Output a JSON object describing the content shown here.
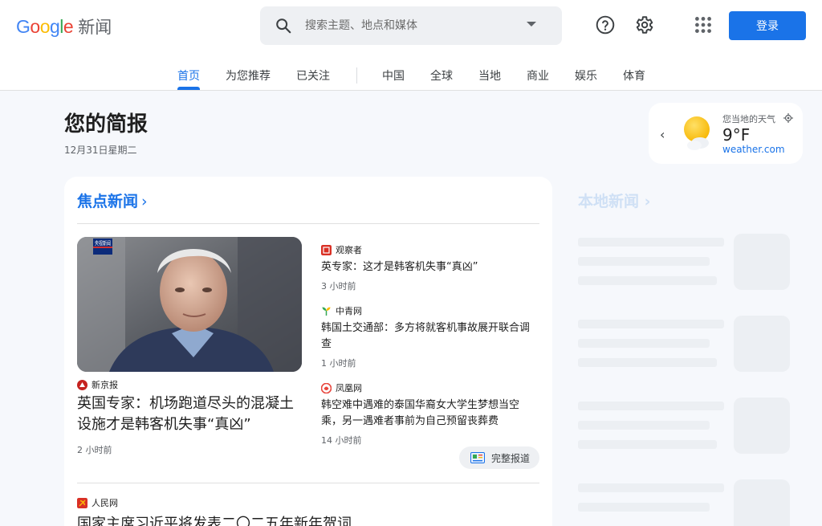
{
  "header": {
    "logo_google": [
      "G",
      "o",
      "o",
      "g",
      "l",
      "e"
    ],
    "logo_suffix": "新闻",
    "search_placeholder": "搜索主题、地点和媒体",
    "login_label": "登录"
  },
  "tabs": [
    "首页",
    "为您推荐",
    "已关注",
    "中国",
    "全球",
    "当地",
    "商业",
    "娱乐",
    "体育"
  ],
  "briefing": {
    "title": "您的简报",
    "date": "12月31日星期二"
  },
  "weather": {
    "label": "您当地的天气",
    "temp": "9°F",
    "source": "weather.com"
  },
  "top_stories": {
    "heading": "焦点新闻",
    "hero": {
      "badge": "央视新闻",
      "source": "新京报",
      "title": "英国专家：机场跑道尽头的混凝土设施才是韩客机失事“真凶”",
      "time": "2 小时前"
    },
    "side": [
      {
        "source": "观察者",
        "title": "英专家：这才是韩客机失事“真凶”",
        "time": "3 小时前"
      },
      {
        "source": "中青网",
        "title": "韩国土交通部：多方将就客机事故展开联合调查",
        "time": "1 小时前"
      },
      {
        "source": "凤凰网",
        "title": "韩空难中遇难的泰国华裔女大学生梦想当空乘，另一遇难者事前为自己预留丧葬费",
        "time": "14 小时前"
      }
    ],
    "full_coverage": "完整报道",
    "next": {
      "source": "人民网",
      "title": "国家主席习近平将发表二〇二五年新年贺词"
    }
  },
  "local_news": {
    "heading": "本地新闻"
  },
  "colors": {
    "accent": "#1a73e8",
    "src_guancha": "#d93025",
    "src_xinjing": "#c5221f",
    "src_renmin": "#d93025"
  }
}
